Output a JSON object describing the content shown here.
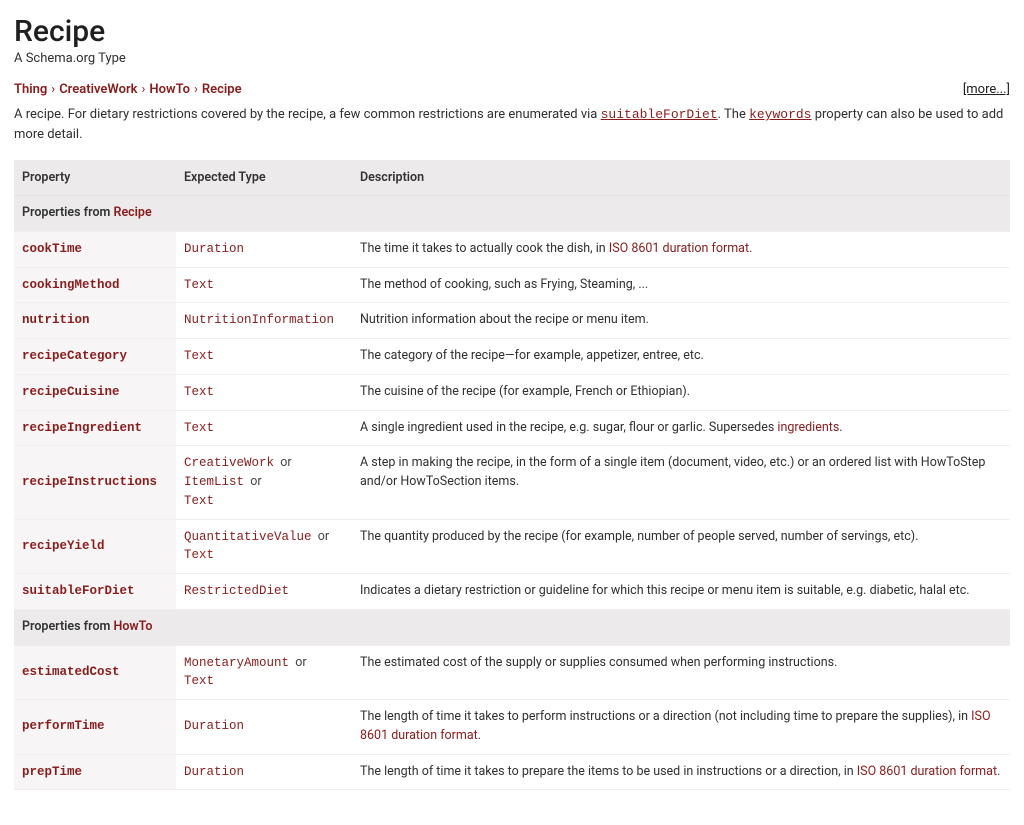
{
  "title": "Recipe",
  "subtitle": "A Schema.org Type",
  "more": "[more...]",
  "breadcrumb": [
    "Thing",
    "CreativeWork",
    "HowTo",
    "Recipe"
  ],
  "intro": {
    "pre": "A recipe. For dietary restrictions covered by the recipe, a few common restrictions are enumerated via ",
    "link1": "suitableForDiet",
    "mid": ". The ",
    "link2": "keywords",
    "post": " property can also be used to add more detail."
  },
  "headers": {
    "property": "Property",
    "expected": "Expected Type",
    "description": "Description"
  },
  "sections": [
    {
      "labelPrefix": "Properties from ",
      "labelLink": "Recipe",
      "rows": [
        {
          "prop": "cookTime",
          "types": [
            "Duration"
          ],
          "desc": {
            "pre": "The time it takes to actually cook the dish, in ",
            "link": "ISO 8601 duration format",
            "post": "."
          }
        },
        {
          "prop": "cookingMethod",
          "types": [
            "Text"
          ],
          "desc": {
            "text": "The method of cooking, such as Frying, Steaming, ..."
          }
        },
        {
          "prop": "nutrition",
          "types": [
            "NutritionInformation"
          ],
          "desc": {
            "text": "Nutrition information about the recipe or menu item."
          }
        },
        {
          "prop": "recipeCategory",
          "types": [
            "Text"
          ],
          "desc": {
            "text": "The category of the recipe—for example, appetizer, entree, etc."
          }
        },
        {
          "prop": "recipeCuisine",
          "types": [
            "Text"
          ],
          "desc": {
            "text": "The cuisine of the recipe (for example, French or Ethiopian)."
          }
        },
        {
          "prop": "recipeIngredient",
          "types": [
            "Text"
          ],
          "desc": {
            "pre": "A single ingredient used in the recipe, e.g. sugar, flour or garlic. Supersedes ",
            "link": "ingredients",
            "post": "."
          }
        },
        {
          "prop": "recipeInstructions",
          "types": [
            "CreativeWork",
            "ItemList",
            "Text"
          ],
          "desc": {
            "text": "A step in making the recipe, in the form of a single item (document, video, etc.) or an ordered list with HowToStep and/or HowToSection items."
          }
        },
        {
          "prop": "recipeYield",
          "types": [
            "QuantitativeValue",
            "Text"
          ],
          "desc": {
            "text": "The quantity produced by the recipe (for example, number of people served, number of servings, etc)."
          }
        },
        {
          "prop": "suitableForDiet",
          "types": [
            "RestrictedDiet"
          ],
          "desc": {
            "text": "Indicates a dietary restriction or guideline for which this recipe or menu item is suitable, e.g. diabetic, halal etc."
          }
        }
      ]
    },
    {
      "labelPrefix": "Properties from ",
      "labelLink": "HowTo",
      "rows": [
        {
          "prop": "estimatedCost",
          "types": [
            "MonetaryAmount",
            "Text"
          ],
          "desc": {
            "text": "The estimated cost of the supply or supplies consumed when performing instructions."
          }
        },
        {
          "prop": "performTime",
          "types": [
            "Duration"
          ],
          "desc": {
            "pre": "The length of time it takes to perform instructions or a direction (not including time to prepare the supplies), in ",
            "link": "ISO 8601 duration format",
            "post": "."
          }
        },
        {
          "prop": "prepTime",
          "types": [
            "Duration"
          ],
          "desc": {
            "pre": "The length of time it takes to prepare the items to be used in instructions or a direction, in ",
            "link": "ISO 8601 duration format",
            "post": "."
          }
        }
      ]
    }
  ],
  "or": "or"
}
